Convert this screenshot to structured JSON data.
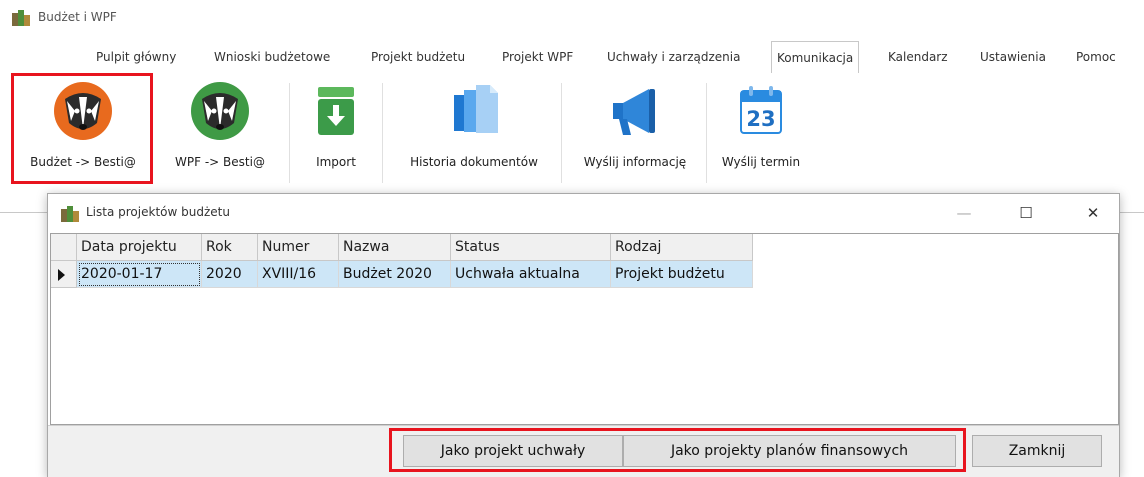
{
  "app": {
    "title": "Budżet i WPF"
  },
  "tabs": [
    {
      "label": "Pulpit główny"
    },
    {
      "label": "Wnioski budżetowe"
    },
    {
      "label": "Projekt budżetu"
    },
    {
      "label": "Projekt WPF"
    },
    {
      "label": "Uchwały i zarządzenia"
    },
    {
      "label": "Komunikacja",
      "active": true
    },
    {
      "label": "Kalendarz"
    },
    {
      "label": "Ustawienia"
    },
    {
      "label": "Pomoc"
    }
  ],
  "ribbon": {
    "buttons": [
      {
        "label": "Budżet -> Besti@",
        "icon": "badger-orange-icon"
      },
      {
        "label": "WPF -> Besti@",
        "icon": "badger-green-icon"
      },
      {
        "label": "Import",
        "icon": "import-box-icon"
      },
      {
        "label": "Historia dokumentów",
        "icon": "document-history-icon"
      },
      {
        "label": "Wyślij informację",
        "icon": "megaphone-icon"
      },
      {
        "label": "Wyślij termin",
        "icon": "calendar-icon",
        "calendar_day": "23"
      }
    ]
  },
  "dialog": {
    "title": "Lista projektów budżetu",
    "window_controls": {
      "minimize": "—",
      "maximize": "☐",
      "close": "✕"
    },
    "columns": [
      "Data projektu",
      "Rok",
      "Numer",
      "Nazwa",
      "Status",
      "Rodzaj"
    ],
    "rows": [
      [
        "2020-01-17",
        "2020",
        "XVIII/16",
        "Budżet 2020",
        "Uchwała aktualna",
        "Projekt budżetu"
      ]
    ],
    "buttons": {
      "as_resolution": "Jako projekt uchwały",
      "as_financial_plans": "Jako projekty planów finansowych",
      "close": "Zamknij"
    }
  },
  "colors": {
    "highlight": "#e8141e",
    "selected_row": "#cde6f7",
    "badger_orange": "#e86a1e",
    "badger_green": "#3f9a45",
    "import_green": "#3c9b49",
    "docs_blue": "#3a91e0",
    "megaphone_blue": "#1f73c8"
  }
}
